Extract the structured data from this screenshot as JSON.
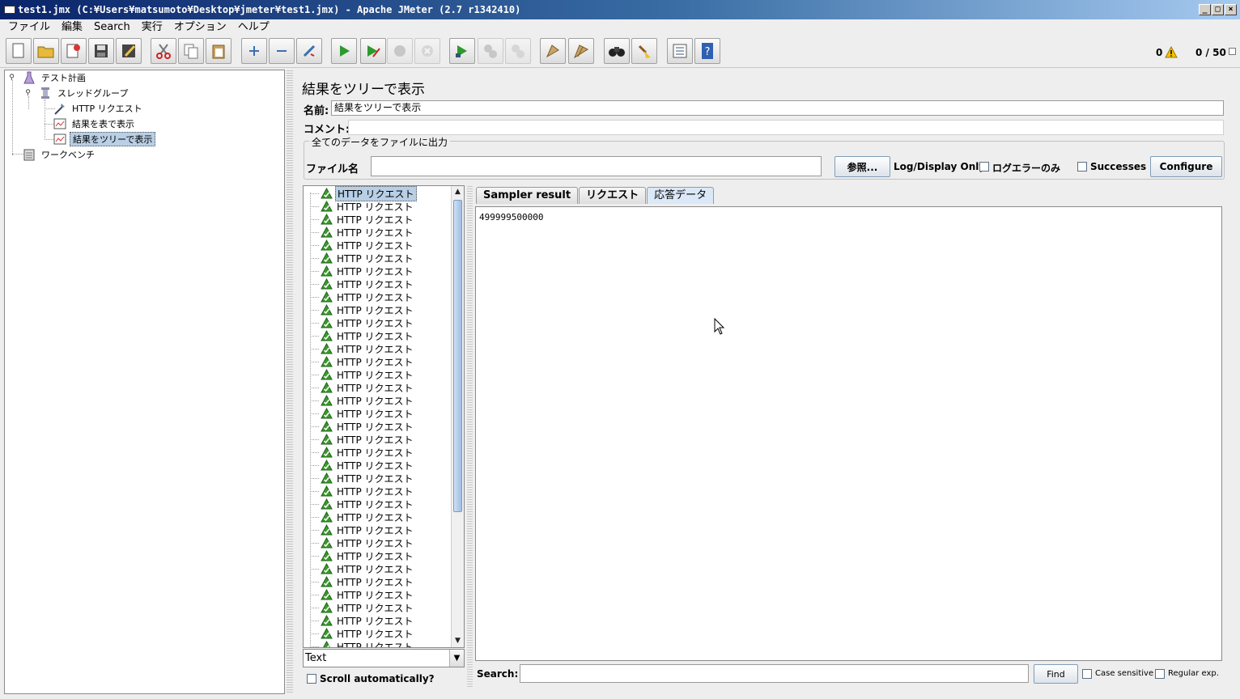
{
  "window": {
    "title": "test1.jmx (C:¥Users¥matsumoto¥Desktop¥jmeter¥test1.jmx) - Apache JMeter (2.7 r1342410)",
    "min": "_",
    "max": "□",
    "close": "×"
  },
  "menu": [
    "ファイル",
    "編集",
    "Search",
    "実行",
    "オプション",
    "ヘルプ"
  ],
  "toolbar": {
    "error_count": "0",
    "threads": "0 / 50"
  },
  "tree": {
    "test_plan": "テスト計画",
    "thread_group": "スレッドグループ",
    "http_request": "HTTP リクエスト",
    "table_results": "結果を表で表示",
    "tree_results": "結果をツリーで表示",
    "workbench": "ワークベンチ"
  },
  "panel": {
    "title": "結果をツリーで表示",
    "name_label": "名前:",
    "name_value": "結果をツリーで表示",
    "comment_label": "コメント:",
    "comment_value": "",
    "file_group": "全てのデータをファイルに出力",
    "filename_label": "ファイル名",
    "filename_value": "",
    "browse": "参照...",
    "log_display": "Log/Display Only:",
    "errors_only": "ログエラーのみ",
    "successes": "Successes",
    "configure": "Configure"
  },
  "results": {
    "item_label": "HTTP リクエスト",
    "count_visible": 36,
    "render_type": "Text",
    "scroll_auto": "Scroll automatically?"
  },
  "tabs": [
    "Sampler result",
    "リクエスト",
    "応答データ"
  ],
  "response": {
    "text": "499999500000"
  },
  "search": {
    "label": "Search:",
    "value": "",
    "find": "Find",
    "case_sensitive": "Case sensitive",
    "regex": "Regular exp."
  },
  "colors": {
    "title_start": "#0a246a",
    "title_end": "#a6caf0",
    "selection": "#b8cfe5",
    "success_icon": "#3b9b2b",
    "active_tab": "#dbe8f7"
  }
}
